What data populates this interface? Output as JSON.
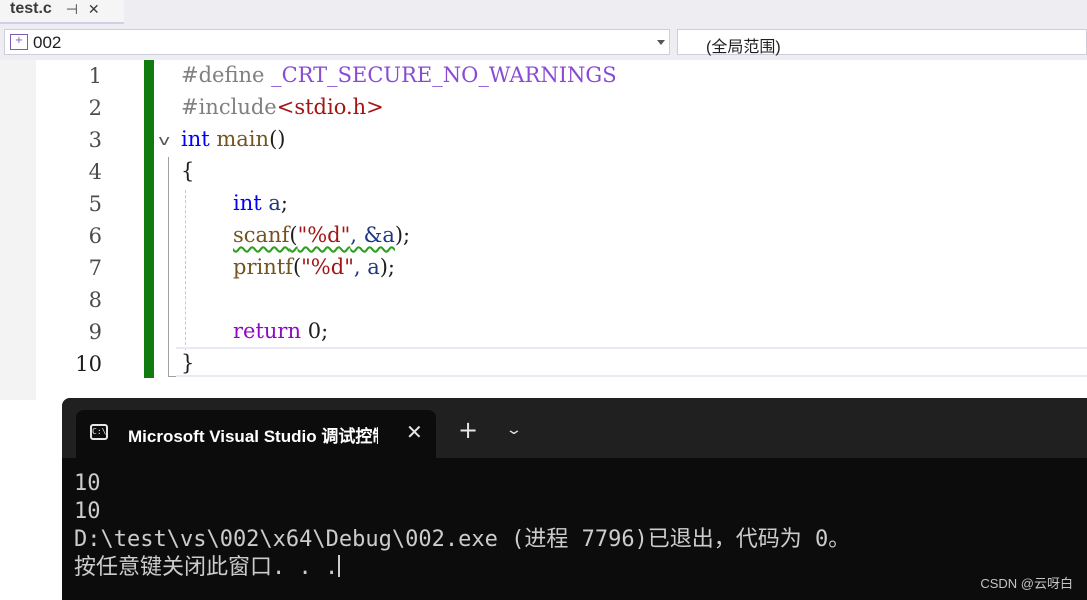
{
  "tab": {
    "title": "test.c",
    "pin_glyph": "⊣",
    "close_glyph": "✕"
  },
  "nav": {
    "project": "002",
    "scope": "(全局范围)"
  },
  "editor": {
    "line_numbers": [
      "1",
      "2",
      "3",
      "4",
      "5",
      "6",
      "7",
      "8",
      "9",
      "10"
    ],
    "line1": {
      "directive": "#define",
      "macro": "_CRT_SECURE_NO_WARNINGS"
    },
    "line2": {
      "directive": "#include",
      "header": "<stdio.h>"
    },
    "line3": {
      "type": "int",
      "name": "main",
      "parens": "()"
    },
    "line4": {
      "text": "{"
    },
    "line5": {
      "type": "int",
      "var": "a",
      "semi": ";"
    },
    "line6": {
      "fn": "scanf",
      "open": "(",
      "fmt": "\"%d\"",
      "args": ", &a",
      "close": ");"
    },
    "line7": {
      "fn": "printf",
      "open": "(",
      "fmt": "\"%d\"",
      "args": ", a",
      "close": ");"
    },
    "line9": {
      "kw": "return",
      "val": "0",
      "semi": ";"
    },
    "line10": {
      "text": "}"
    }
  },
  "console": {
    "tab_title": "Microsoft Visual Studio 调试控制台",
    "close_glyph": "✕",
    "new_tab_glyph": "+",
    "dropdown_glyph": "⌄",
    "lines": [
      "10",
      "10",
      "D:\\test\\vs\\002\\x64\\Debug\\002.exe (进程 7796)已退出，代码为 0。",
      "按任意键关闭此窗口. . ."
    ]
  },
  "watermark": "CSDN @云呀白"
}
